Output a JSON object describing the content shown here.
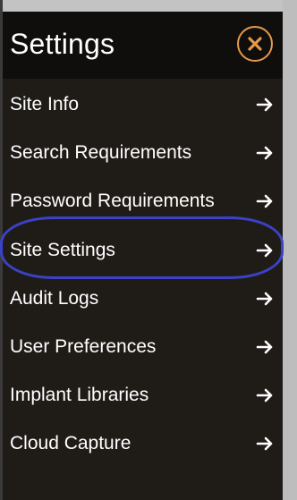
{
  "settings_panel": {
    "title": "Settings",
    "close_icon": "close-x-icon",
    "accent_color": "#e49a4a",
    "highlight_color": "#3b42c8",
    "items": [
      {
        "label": "Site Info",
        "icon": "arrow-right-icon"
      },
      {
        "label": "Search Requirements",
        "icon": "arrow-right-icon"
      },
      {
        "label": "Password Requirements",
        "icon": "arrow-right-icon"
      },
      {
        "label": "Site Settings",
        "icon": "arrow-right-icon",
        "highlighted": true
      },
      {
        "label": "Audit Logs",
        "icon": "arrow-right-icon"
      },
      {
        "label": "User Preferences",
        "icon": "arrow-right-icon"
      },
      {
        "label": "Implant Libraries",
        "icon": "arrow-right-icon"
      },
      {
        "label": "Cloud Capture",
        "icon": "arrow-right-icon"
      }
    ]
  }
}
